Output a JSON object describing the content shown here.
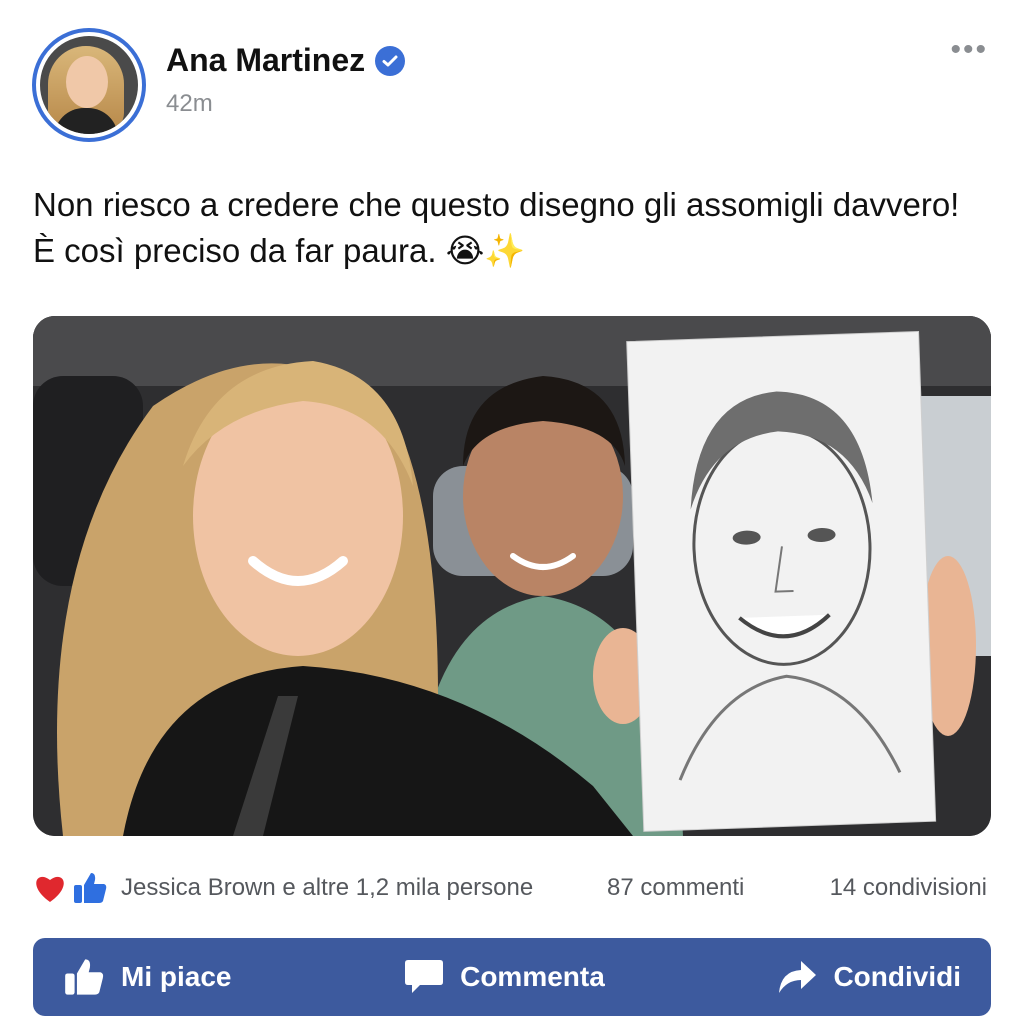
{
  "post": {
    "author": "Ana Martinez",
    "timestamp": "42m",
    "caption_line1": "Non riesco a credere che questo disegno gli assomigli davvero!",
    "caption_line2": "È così preciso da far paura. 😭✨",
    "more_label": "•••"
  },
  "stats": {
    "reactions_text": "Jessica Brown e altre 1,2 mila persone",
    "comments": "87 commenti",
    "shares": "14 condivisioni"
  },
  "actions": {
    "like": "Mi piace",
    "comment": "Commenta",
    "share": "Condividi"
  },
  "colors": {
    "accent": "#3b6fd6",
    "action_bar": "#3d5a9e",
    "muted_text": "#8a8d91"
  },
  "icons": [
    "verified-badge-icon",
    "more-options-icon",
    "heart-icon",
    "thumbs-up-icon",
    "comment-icon",
    "share-icon"
  ]
}
